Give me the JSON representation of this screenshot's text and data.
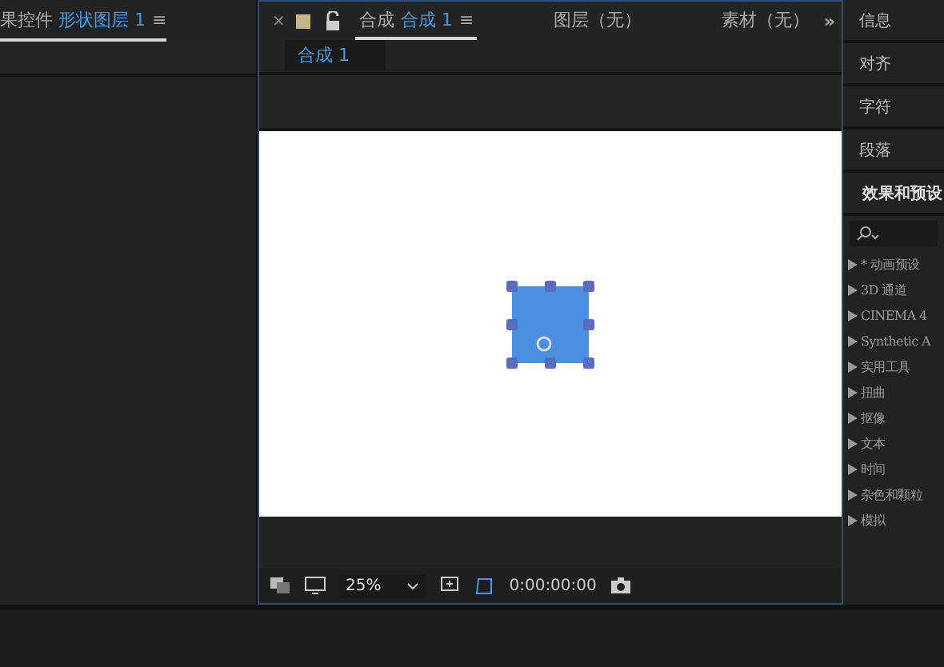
{
  "left_panel": {
    "title_prefix": "果控件",
    "title_layer": "形状图层 1",
    "menu": "≡"
  },
  "viewer": {
    "close": "×",
    "tabs": [
      {
        "kind": "comp",
        "prefix": "合成",
        "label": "合成 1",
        "menu": "≡",
        "selected": true
      },
      {
        "kind": "plain",
        "label": "图层（无）",
        "selected": false
      },
      {
        "kind": "plain",
        "label": "素材（无）",
        "selected": false
      }
    ],
    "overflow": "»",
    "subtab": "合成 1",
    "toolbar": {
      "zoom": "25%",
      "timecode": "0:00:00:00"
    }
  },
  "right_panel": {
    "headers": [
      "信息",
      "对齐",
      "字符",
      "段落"
    ],
    "effects_title": "效果和预设",
    "items": [
      {
        "label": "* 动画预设"
      },
      {
        "label": "3D 通道"
      },
      {
        "label": "CINEMA 4"
      },
      {
        "label": "Synthetic A"
      },
      {
        "label": "实用工具"
      },
      {
        "label": "扭曲"
      },
      {
        "label": "抠像"
      },
      {
        "label": "文本"
      },
      {
        "label": "时间"
      },
      {
        "label": "杂色和颗粒"
      },
      {
        "label": "模拟"
      }
    ]
  }
}
